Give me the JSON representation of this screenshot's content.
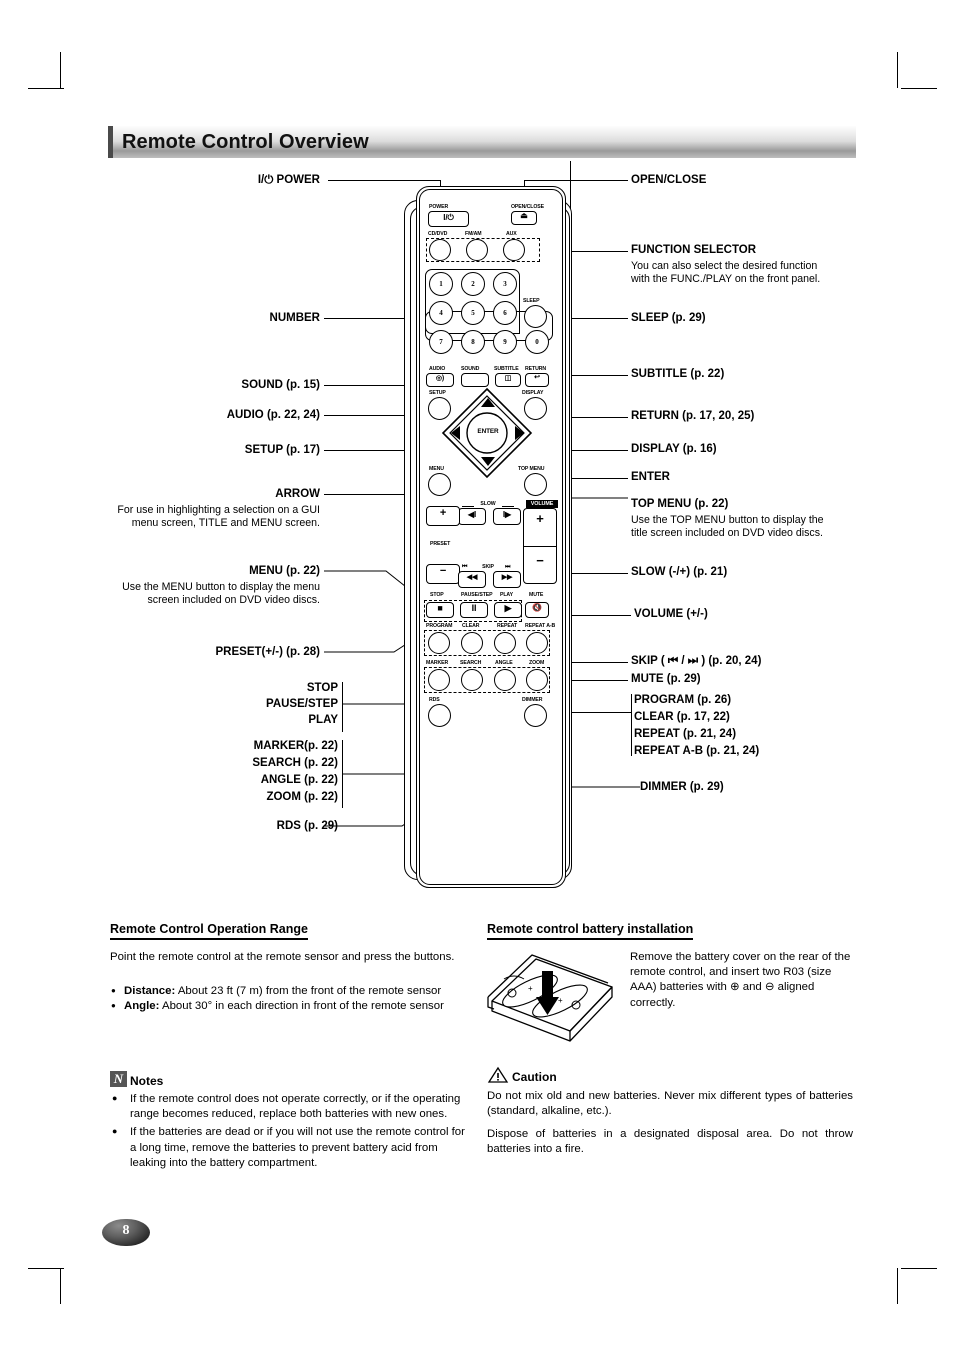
{
  "page": {
    "number": "8",
    "title": "Remote Control Overview"
  },
  "left_callouts": [
    {
      "id": "power",
      "label": "I/⏻  POWER"
    },
    {
      "id": "number",
      "label": "NUMBER"
    },
    {
      "id": "sound",
      "label": "SOUND (p. 15)"
    },
    {
      "id": "audio",
      "label": "AUDIO (p. 22, 24)"
    },
    {
      "id": "setup",
      "label": "SETUP (p. 17)"
    },
    {
      "id": "arrow",
      "label": "ARROW",
      "desc": "For use in highlighting a selection on a GUI menu screen, TITLE and MENU screen."
    },
    {
      "id": "menu",
      "label": "MENU (p. 22)",
      "desc": "Use the MENU button to display the menu screen included on DVD video discs."
    },
    {
      "id": "preset",
      "label": "PRESET(+/-) (p. 28)"
    },
    {
      "id": "stop",
      "label": "STOP"
    },
    {
      "id": "pause_step",
      "label": "PAUSE/STEP"
    },
    {
      "id": "play",
      "label": "PLAY"
    },
    {
      "id": "marker",
      "label": "MARKER(p. 22)"
    },
    {
      "id": "search",
      "label": "SEARCH (p. 22)"
    },
    {
      "id": "angle",
      "label": "ANGLE (p. 22)"
    },
    {
      "id": "zoom",
      "label": "ZOOM (p. 22)"
    },
    {
      "id": "rds",
      "label": "RDS (p. 29)"
    }
  ],
  "right_callouts": [
    {
      "id": "open_close",
      "label": "OPEN/CLOSE"
    },
    {
      "id": "function_selector",
      "label": "FUNCTION SELECTOR",
      "desc": "You can also select the desired function with the FUNC./PLAY on the front panel."
    },
    {
      "id": "sleep",
      "label": "SLEEP (p. 29)"
    },
    {
      "id": "subtitle",
      "label": "SUBTITLE (p. 22)"
    },
    {
      "id": "return",
      "label": "RETURN (p. 17, 20, 25)"
    },
    {
      "id": "display",
      "label": "DISPLAY (p. 16)"
    },
    {
      "id": "enter",
      "label": "ENTER"
    },
    {
      "id": "top_menu",
      "label": "TOP MENU (p. 22)",
      "desc": "Use the TOP MENU button to display the title screen included on DVD video discs."
    },
    {
      "id": "slow",
      "label": "SLOW (-/+) (p. 21)"
    },
    {
      "id": "volume",
      "label": "VOLUME (+/-)"
    },
    {
      "id": "skip",
      "label": "SKIP ( ⏮ / ⏭ ) (p. 20, 24)"
    },
    {
      "id": "mute",
      "label": "MUTE (p. 29)"
    },
    {
      "id": "program",
      "label": "PROGRAM (p. 26)"
    },
    {
      "id": "clear",
      "label": "CLEAR (p. 17, 22)"
    },
    {
      "id": "repeat",
      "label": "REPEAT (p. 21, 24)"
    },
    {
      "id": "repeat_ab",
      "label": "REPEAT A-B (p. 21, 24)"
    },
    {
      "id": "dimmer",
      "label": "DIMMER (p. 29)"
    }
  ],
  "remote": {
    "captions": {
      "power": "POWER",
      "open_close": "OPEN/CLOSE",
      "cd_dvd": "CD/DVD",
      "fm_am": "FM/AM",
      "aux": "AUX",
      "sleep": "SLEEP",
      "audio": "AUDIO",
      "sound": "SOUND",
      "subtitle": "SUBTITLE",
      "return": "RETURN",
      "setup": "SETUP",
      "display": "DISPLAY",
      "menu": "MENU",
      "top_menu": "TOP MENU",
      "slow": "SLOW",
      "volume": "VOLUME",
      "preset": "PRESET",
      "skip": "SKIP",
      "stop": "STOP",
      "pause_step": "PAUSE/STEP",
      "play": "PLAY",
      "mute": "MUTE",
      "program": "PROGRAM",
      "clear": "CLEAR",
      "repeat": "REPEAT",
      "repeat_ab": "REPEAT A-B",
      "marker": "MARKER",
      "search": "SEARCH",
      "angle": "ANGLE",
      "zoom": "ZOOM",
      "rds": "RDS",
      "dimmer": "DIMMER",
      "enter": "ENTER",
      "power_glyph": "I/⏻",
      "eject_glyph": "⏏",
      "plus": "+",
      "minus": "−",
      "slow_minus_glyph": "◀I",
      "slow_plus_glyph": "I▶",
      "skip_prev_glyph": "◀◀",
      "skip_next_glyph": "▶▶",
      "skip_prev_mini": "⏮",
      "skip_next_mini": "⏭",
      "stop_glyph": "■",
      "pause_glyph": "II",
      "play_glyph": "▶",
      "mute_glyph": "🔇"
    },
    "numbers": [
      "1",
      "2",
      "3",
      "4",
      "5",
      "6",
      "7",
      "8",
      "9",
      "0"
    ]
  },
  "sections": {
    "range": {
      "heading": "Remote Control Operation Range",
      "intro": "Point the remote control at the remote sensor and press the buttons.",
      "bullets": [
        {
          "term": "Distance:",
          "text": " About 23 ft (7 m) from the front of the remote sensor"
        },
        {
          "term": "Angle:",
          "text": "  About 30° in each direction in front of the remote sensor"
        }
      ]
    },
    "notes": {
      "heading": "Notes",
      "icon": "N",
      "items": [
        "If the remote control does not operate correctly, or if the operating range becomes reduced, replace both batteries with new ones.",
        "If the batteries are dead or if you will not use the remote control for a long time, remove the batteries to prevent battery acid from leaking into the battery compartment."
      ]
    },
    "battery": {
      "heading": "Remote control battery installation",
      "text": "Remove the battery cover on the rear of the remote control, and insert two R03 (size AAA) batteries with ⊕ and ⊖ aligned correctly."
    },
    "caution": {
      "heading": "Caution",
      "paragraphs": [
        "Do not mix old and new batteries. Never mix different types of batteries (standard, alkaline, etc.).",
        "Dispose of batteries in a designated disposal area. Do not throw batteries into a fire."
      ]
    }
  }
}
